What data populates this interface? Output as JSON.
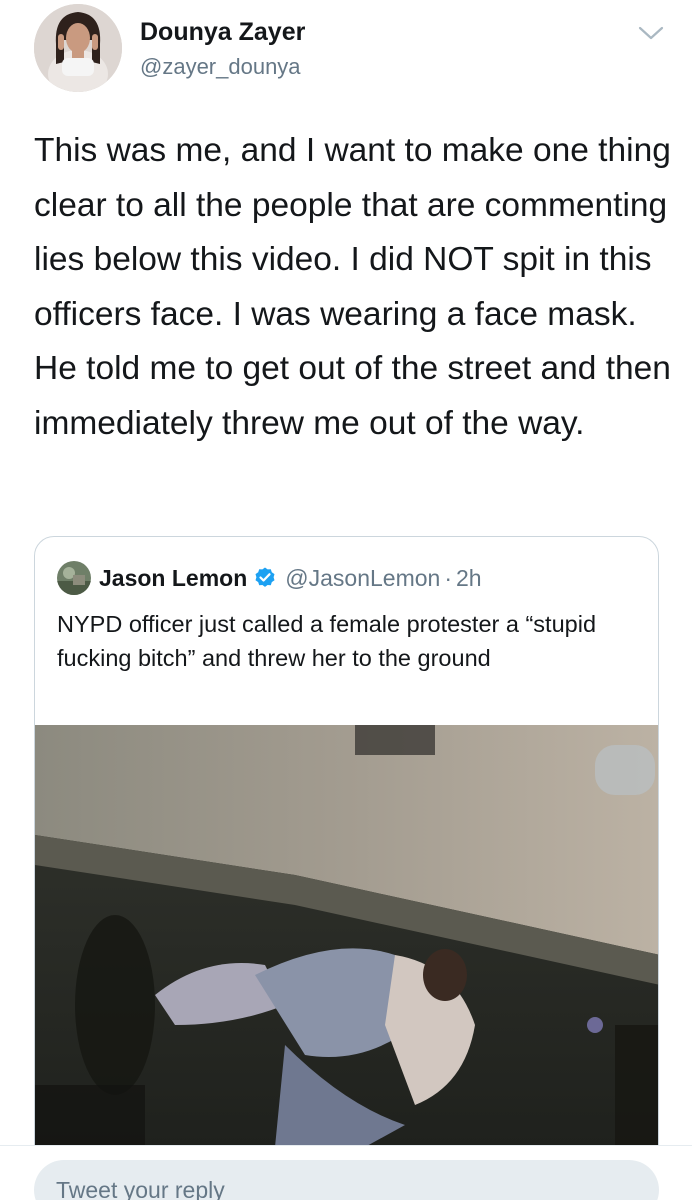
{
  "author": {
    "display_name": "Dounya Zayer",
    "handle": "@zayer_dounya",
    "avatar_icon": "profile-avatar"
  },
  "tweet": {
    "text": "This was me, and I want to make one thing clear to all the people that are commenting lies below this video. I did NOT spit in this officers face. I was wearing a face mask. He told me to get out of the street and then immediately threw me out of the way."
  },
  "quote": {
    "author_name": "Jason Lemon",
    "author_handle": "@JasonLemon",
    "separator": "·",
    "time": "2h",
    "verified": true,
    "text": "NYPD officer just called a female protester a “stupid fucking bitch” and threw her to the ground",
    "media": "video-thumbnail"
  },
  "reply": {
    "placeholder": "Tweet your reply"
  },
  "colors": {
    "primary_text": "#14171a",
    "secondary_text": "#657786",
    "verified_blue": "#1da1f2",
    "border": "#ccd6dd",
    "reply_bg": "#e6ecf0"
  }
}
